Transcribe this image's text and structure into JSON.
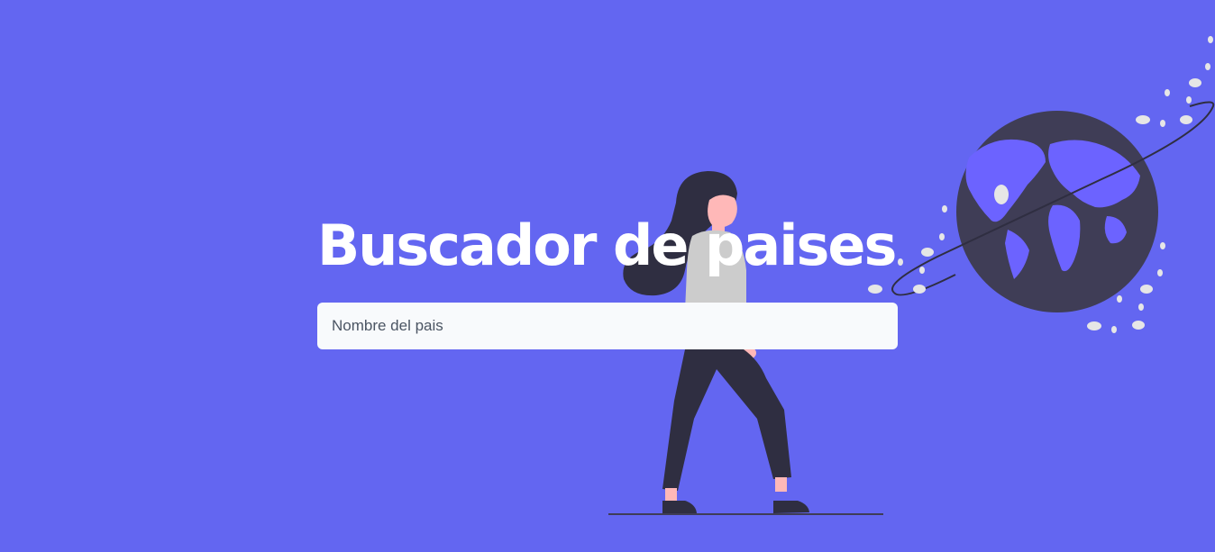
{
  "page": {
    "background_color": "#6366f1"
  },
  "hero": {
    "title": "Buscador de paises",
    "title_color": "#ffffff"
  },
  "search": {
    "placeholder": "Nombre del pais",
    "value": ""
  },
  "illustration": {
    "figure": "woman-walking-illustration",
    "globe": "globe-with-orbit-illustration",
    "colors": {
      "dark": "#2f2e41",
      "globe": "#3f3d56",
      "continents": "#6c63ff",
      "skin": "#ffb8b8",
      "shirt": "#cccccc",
      "dots": "#e6e6e6"
    }
  }
}
